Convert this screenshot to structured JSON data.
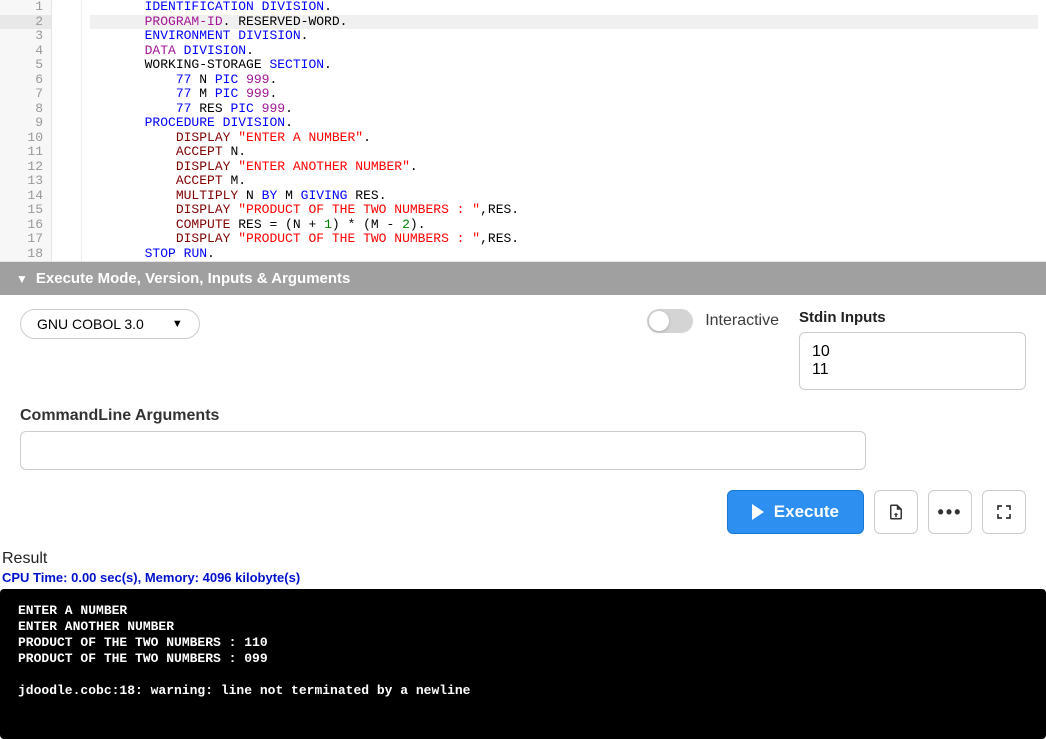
{
  "editor": {
    "active_line": 2,
    "lines": [
      {
        "num": 1,
        "tokens": [
          {
            "t": "       ",
            "c": ""
          },
          {
            "t": "IDENTIFICATION",
            "c": "kw-blue"
          },
          {
            "t": " ",
            "c": ""
          },
          {
            "t": "DIVISION",
            "c": "kw-blue"
          },
          {
            "t": ".",
            "c": ""
          }
        ]
      },
      {
        "num": 2,
        "tokens": [
          {
            "t": "       ",
            "c": ""
          },
          {
            "t": "PROGRAM-ID",
            "c": "kw-purple"
          },
          {
            "t": ". RESERVED-WORD.",
            "c": ""
          }
        ]
      },
      {
        "num": 3,
        "tokens": [
          {
            "t": "       ",
            "c": ""
          },
          {
            "t": "ENVIRONMENT",
            "c": "kw-blue"
          },
          {
            "t": " ",
            "c": ""
          },
          {
            "t": "DIVISION",
            "c": "kw-blue"
          },
          {
            "t": ".",
            "c": ""
          }
        ]
      },
      {
        "num": 4,
        "tokens": [
          {
            "t": "       ",
            "c": ""
          },
          {
            "t": "DATA",
            "c": "kw-purple"
          },
          {
            "t": " ",
            "c": ""
          },
          {
            "t": "DIVISION",
            "c": "kw-blue"
          },
          {
            "t": ".",
            "c": ""
          }
        ]
      },
      {
        "num": 5,
        "tokens": [
          {
            "t": "       WORKING-STORAGE ",
            "c": ""
          },
          {
            "t": "SECTION",
            "c": "kw-blue"
          },
          {
            "t": ".",
            "c": ""
          }
        ]
      },
      {
        "num": 6,
        "tokens": [
          {
            "t": "           ",
            "c": ""
          },
          {
            "t": "77",
            "c": "kw-blue"
          },
          {
            "t": " N ",
            "c": ""
          },
          {
            "t": "PIC",
            "c": "kw-blue"
          },
          {
            "t": " ",
            "c": ""
          },
          {
            "t": "999",
            "c": "kw-purple"
          },
          {
            "t": ".",
            "c": ""
          }
        ]
      },
      {
        "num": 7,
        "tokens": [
          {
            "t": "           ",
            "c": ""
          },
          {
            "t": "77",
            "c": "kw-blue"
          },
          {
            "t": " M ",
            "c": ""
          },
          {
            "t": "PIC",
            "c": "kw-blue"
          },
          {
            "t": " ",
            "c": ""
          },
          {
            "t": "999",
            "c": "kw-purple"
          },
          {
            "t": ".",
            "c": ""
          }
        ]
      },
      {
        "num": 8,
        "tokens": [
          {
            "t": "           ",
            "c": ""
          },
          {
            "t": "77",
            "c": "kw-blue"
          },
          {
            "t": " RES ",
            "c": ""
          },
          {
            "t": "PIC",
            "c": "kw-blue"
          },
          {
            "t": " ",
            "c": ""
          },
          {
            "t": "999",
            "c": "kw-purple"
          },
          {
            "t": ".",
            "c": ""
          }
        ]
      },
      {
        "num": 9,
        "tokens": [
          {
            "t": "       ",
            "c": ""
          },
          {
            "t": "PROCEDURE",
            "c": "kw-blue"
          },
          {
            "t": " ",
            "c": ""
          },
          {
            "t": "DIVISION",
            "c": "kw-blue"
          },
          {
            "t": ".",
            "c": ""
          }
        ]
      },
      {
        "num": 10,
        "tokens": [
          {
            "t": "           ",
            "c": ""
          },
          {
            "t": "DISPLAY",
            "c": "kw-darkred"
          },
          {
            "t": " ",
            "c": ""
          },
          {
            "t": "\"ENTER A NUMBER\"",
            "c": "str-red"
          },
          {
            "t": ".",
            "c": ""
          }
        ]
      },
      {
        "num": 11,
        "tokens": [
          {
            "t": "           ",
            "c": ""
          },
          {
            "t": "ACCEPT",
            "c": "kw-darkred"
          },
          {
            "t": " N.",
            "c": ""
          }
        ]
      },
      {
        "num": 12,
        "tokens": [
          {
            "t": "           ",
            "c": ""
          },
          {
            "t": "DISPLAY",
            "c": "kw-darkred"
          },
          {
            "t": " ",
            "c": ""
          },
          {
            "t": "\"ENTER ANOTHER NUMBER\"",
            "c": "str-red"
          },
          {
            "t": ".",
            "c": ""
          }
        ]
      },
      {
        "num": 13,
        "tokens": [
          {
            "t": "           ",
            "c": ""
          },
          {
            "t": "ACCEPT",
            "c": "kw-darkred"
          },
          {
            "t": " M.",
            "c": ""
          }
        ]
      },
      {
        "num": 14,
        "tokens": [
          {
            "t": "           ",
            "c": ""
          },
          {
            "t": "MULTIPLY",
            "c": "kw-darkred"
          },
          {
            "t": " N ",
            "c": ""
          },
          {
            "t": "BY",
            "c": "kw-blue"
          },
          {
            "t": " M ",
            "c": ""
          },
          {
            "t": "GIVING",
            "c": "kw-blue"
          },
          {
            "t": " RES.",
            "c": ""
          }
        ]
      },
      {
        "num": 15,
        "tokens": [
          {
            "t": "           ",
            "c": ""
          },
          {
            "t": "DISPLAY",
            "c": "kw-darkred"
          },
          {
            "t": " ",
            "c": ""
          },
          {
            "t": "\"PRODUCT OF THE TWO NUMBERS : \"",
            "c": "str-red"
          },
          {
            "t": ",RES.",
            "c": ""
          }
        ]
      },
      {
        "num": 16,
        "tokens": [
          {
            "t": "           ",
            "c": ""
          },
          {
            "t": "COMPUTE",
            "c": "kw-darkred"
          },
          {
            "t": " RES = (N + ",
            "c": ""
          },
          {
            "t": "1",
            "c": "kw-green"
          },
          {
            "t": ") * (M - ",
            "c": ""
          },
          {
            "t": "2",
            "c": "kw-green"
          },
          {
            "t": ").",
            "c": ""
          }
        ]
      },
      {
        "num": 17,
        "tokens": [
          {
            "t": "           ",
            "c": ""
          },
          {
            "t": "DISPLAY",
            "c": "kw-darkred"
          },
          {
            "t": " ",
            "c": ""
          },
          {
            "t": "\"PRODUCT OF THE TWO NUMBERS : \"",
            "c": "str-red"
          },
          {
            "t": ",RES.",
            "c": ""
          }
        ]
      },
      {
        "num": 18,
        "tokens": [
          {
            "t": "       ",
            "c": ""
          },
          {
            "t": "STOP",
            "c": "kw-blue"
          },
          {
            "t": " ",
            "c": ""
          },
          {
            "t": "RUN",
            "c": "kw-blue"
          },
          {
            "t": ".",
            "c": ""
          }
        ]
      }
    ]
  },
  "section_header": "Execute Mode, Version, Inputs & Arguments",
  "version_select": "GNU COBOL 3.0",
  "interactive_label": "Interactive",
  "stdin_label": "Stdin Inputs",
  "stdin_value": "10\n11",
  "cmdline_label": "CommandLine Arguments",
  "cmdline_value": "",
  "execute_button": "Execute",
  "result_label": "Result",
  "result_stats": "CPU Time: 0.00 sec(s), Memory: 4096 kilobyte(s)",
  "terminal_output": "ENTER A NUMBER\nENTER ANOTHER NUMBER\nPRODUCT OF THE TWO NUMBERS : 110\nPRODUCT OF THE TWO NUMBERS : 099\n\njdoodle.cobc:18: warning: line not terminated by a newline"
}
